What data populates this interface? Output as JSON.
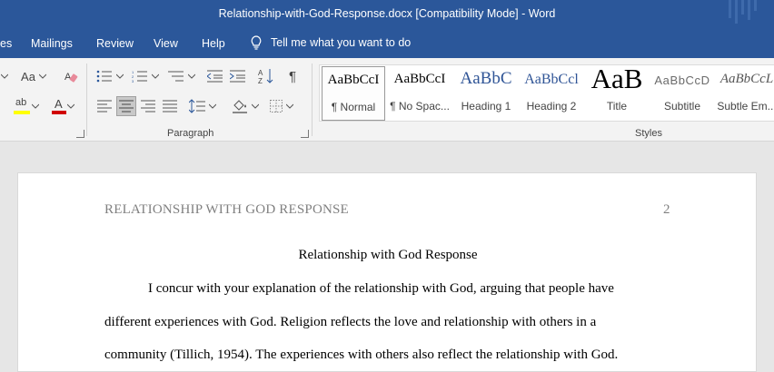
{
  "window": {
    "title": "Relationship-with-God-Response.docx [Compatibility Mode]  -  Word"
  },
  "ribbon_tabs": [
    {
      "label": "es"
    },
    {
      "label": "Mailings"
    },
    {
      "label": "Review"
    },
    {
      "label": "View"
    },
    {
      "label": "Help"
    }
  ],
  "tell_me": {
    "icon": "lightbulb-icon",
    "placeholder": "Tell me what you want to do"
  },
  "font_group": {
    "change_case_label": "Aa",
    "highlight_label": "ab",
    "font_color_label": "A",
    "highlight_color": "#ffff00",
    "font_color": "#d00000"
  },
  "paragraph_group": {
    "label": "Paragraph",
    "sort_label": "A↓Z",
    "pilcrow": "¶"
  },
  "styles_group": {
    "label": "Styles",
    "styles": [
      {
        "preview": "AaBbCcI",
        "name": "¶ Normal",
        "selected": true
      },
      {
        "preview": "AaBbCcI",
        "name": "¶ No Spac..."
      },
      {
        "preview": "AaBbC",
        "name": "Heading 1"
      },
      {
        "preview": "AaBbCcl",
        "name": "Heading 2"
      },
      {
        "preview": "AaB",
        "name": "Title"
      },
      {
        "preview": "AaBbCcD",
        "name": "Subtitle"
      },
      {
        "preview": "AaBbCcL",
        "name": "Subtle Em..."
      }
    ]
  },
  "document": {
    "running_head": "RELATIONSHIP WITH GOD RESPONSE",
    "page_number": "2",
    "title": "Relationship with God Response",
    "lines": [
      "I concur with your explanation of the relationship with God, arguing that people have",
      "different experiences with God. Religion reflects the love and relationship with others in a",
      "community (Tillich, 1954). The experiences with others also reflect the relationship with God."
    ]
  }
}
